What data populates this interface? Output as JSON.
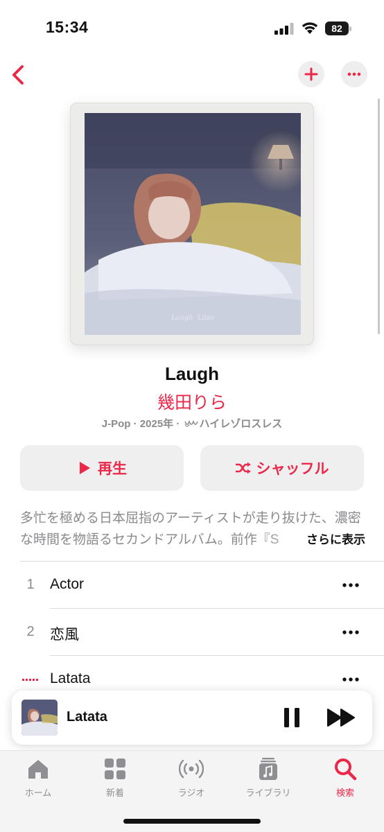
{
  "status_bar": {
    "time": "15:34",
    "battery": "82"
  },
  "album": {
    "title": "Laugh",
    "artist": "幾田りら",
    "meta_genre_year": "J-Pop · 2025年 · ",
    "meta_quality": "ハイレゾロスレス",
    "artwork_signature": "Laugh",
    "artwork_label": "Lilas"
  },
  "actions": {
    "play_label": "再生",
    "shuffle_label": "シャッフル"
  },
  "description": {
    "text": "多忙を極める日本屈指のアーティストが走り抜けた、濃密な時間を物語るセカンドアルバム。前作『S",
    "more_label": "さらに表示"
  },
  "tracks": [
    {
      "number": "1",
      "title": "Actor"
    },
    {
      "number": "2",
      "title": "恋風"
    },
    {
      "number": "",
      "title": "Latata",
      "playing": true
    }
  ],
  "mini_player": {
    "title": "Latata"
  },
  "tabs": [
    {
      "label": "ホーム",
      "icon": "house-icon"
    },
    {
      "label": "新着",
      "icon": "grid-icon"
    },
    {
      "label": "ラジオ",
      "icon": "radio-icon"
    },
    {
      "label": "ライブラリ",
      "icon": "library-icon"
    },
    {
      "label": "検索",
      "icon": "search-icon",
      "active": true
    }
  ],
  "colors": {
    "accent": "#ea2849",
    "secondary_text": "#8a8a8e",
    "button_bg": "#efeff0"
  }
}
